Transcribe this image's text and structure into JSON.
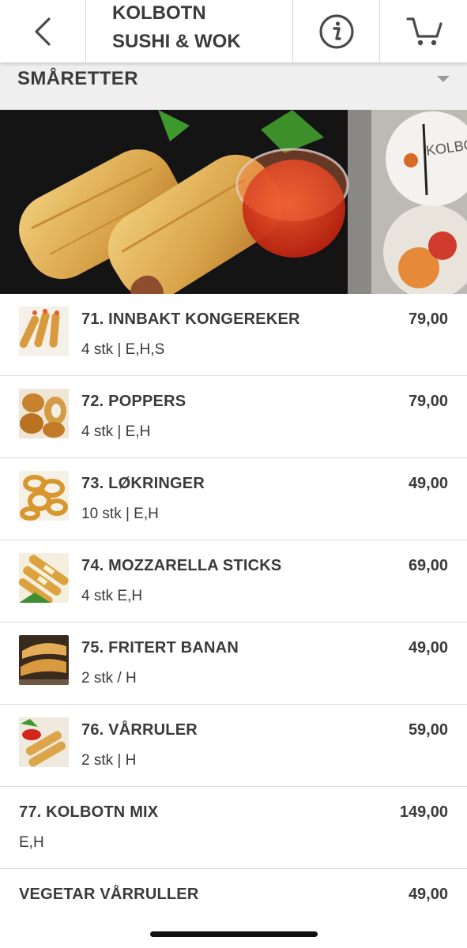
{
  "header": {
    "title_line1": "KOLBOTN",
    "title_line2": "SUSHI & WOK",
    "back_icon": "chevron-left-icon",
    "info_icon": "info-circle-icon",
    "cart_icon": "cart-icon"
  },
  "category": {
    "label": "SMÅRETTER",
    "caret_icon": "caret-down-icon"
  },
  "hero": {
    "logo_text": "KOLBOTN"
  },
  "menu_items": [
    {
      "name": "71. INNBAKT KONGEREKER",
      "desc": "4 stk | E,H,S",
      "price": "79,00"
    },
    {
      "name": "72. POPPERS",
      "desc": "4 stk | E,H",
      "price": "79,00"
    },
    {
      "name": "73. LØKRINGER",
      "desc": "10 stk | E,H",
      "price": "49,00"
    },
    {
      "name": "74. MOZZARELLA STICKS",
      "desc": "4 stk E,H",
      "price": "69,00"
    },
    {
      "name": "75. FRITERT BANAN",
      "desc": "2 stk / H",
      "price": "49,00"
    },
    {
      "name": "76. VÅRRULER",
      "desc": "2 stk | H",
      "price": "59,00"
    },
    {
      "name": "77. KOLBOTN MIX",
      "desc": "E,H",
      "price": "149,00"
    },
    {
      "name": "VEGETAR VÅRRULLER",
      "desc": "",
      "price": "49,00"
    }
  ],
  "colors": {
    "text": "#3a3a3a",
    "category_bg": "#efefef",
    "divider": "#dcdcdc"
  }
}
